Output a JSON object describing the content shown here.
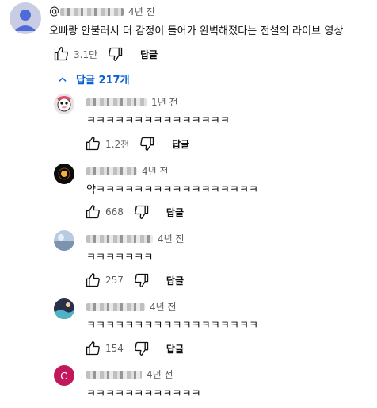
{
  "comment": {
    "handle_prefix": "@",
    "time": "4년 전",
    "text": "오빠랑 안불러서 더 감정이 들어가 완벽해졌다는 전설의 라이브 영상",
    "likes": "3.1만",
    "reply_label": "답글"
  },
  "replies_toggle": {
    "label": "답글 217개"
  },
  "replies": [
    {
      "time": "1년 전",
      "text": "ㅋㅋㅋㅋㅋㅋㅋㅋㅋㅋㅋㅋㅋㅋㅋ",
      "likes": "1.2천",
      "reply_label": "답글"
    },
    {
      "time": "4년 전",
      "text": "약ㅋㅋㅋㅋㅋㅋㅋㅋㅋㅋㅋㅋㅋㅋㅋㅋㅋ",
      "likes": "668",
      "reply_label": "답글"
    },
    {
      "time": "4년 전",
      "text": "ㅋㅋㅋㅋㅋㅋㅋ",
      "likes": "257",
      "reply_label": "답글"
    },
    {
      "time": "4년 전",
      "text": "ㅋㅋㅋㅋㅋㅋㅋㅋㅋㅋㅋㅋㅋㅋㅋㅋㅋㅋ",
      "likes": "154",
      "reply_label": "답글"
    },
    {
      "time": "4년 전",
      "text": "ㅋㅋㅋㅋㅋㅋㅋㅋㅋㅋㅋㅋ",
      "avatar_letter": "C"
    }
  ],
  "colors": {
    "accent": "#065fd4",
    "avatar_c": "#c2185b"
  }
}
